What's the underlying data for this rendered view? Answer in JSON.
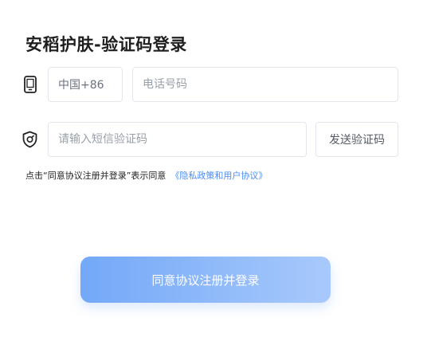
{
  "page": {
    "title": "安稻护肤-验证码登录"
  },
  "phone_row": {
    "country_code": "中国+86",
    "phone_placeholder": "电话号码",
    "icon": "mobile-phone-icon"
  },
  "code_row": {
    "code_placeholder": "请输入短信验证码",
    "send_button_label": "发送验证码",
    "icon": "shield-check-icon"
  },
  "agreement": {
    "text": "点击“同意协议注册并登录”表示同意",
    "link_text": "《隐私政策和用户协议》"
  },
  "submit": {
    "label": "同意协议注册并登录"
  },
  "colors": {
    "link": "#4d8cf5",
    "button_gradient_start": "#73a8f8",
    "button_gradient_end": "#a8c9fb",
    "border": "#e3e6ec"
  }
}
